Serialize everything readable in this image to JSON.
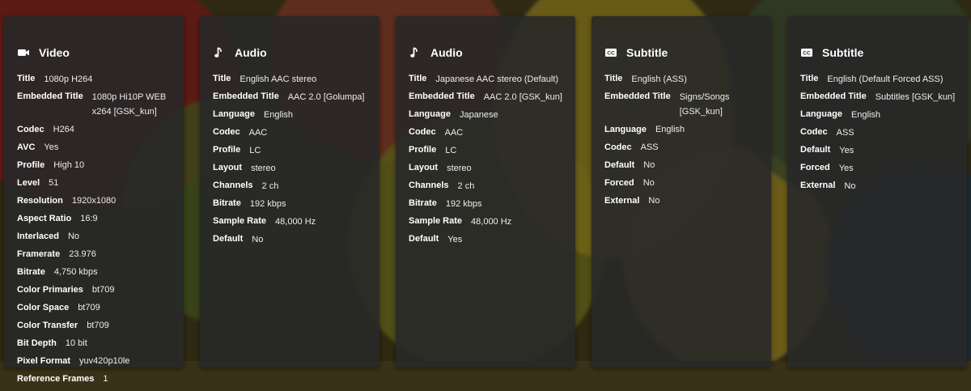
{
  "colors": {
    "card_bg": "#282828",
    "text": "#ffffff",
    "value_text": "#ededed"
  },
  "cards": [
    {
      "icon": "video-camera-icon",
      "title": "Video",
      "rows": [
        {
          "label": "Title",
          "value": "1080p H264"
        },
        {
          "label": "Embedded Title",
          "value": "1080p Hi10P WEB x264 [GSK_kun]"
        },
        {
          "label": "Codec",
          "value": "H264"
        },
        {
          "label": "AVC",
          "value": "Yes"
        },
        {
          "label": "Profile",
          "value": "High 10"
        },
        {
          "label": "Level",
          "value": "51"
        },
        {
          "label": "Resolution",
          "value": "1920x1080"
        },
        {
          "label": "Aspect Ratio",
          "value": "16:9"
        },
        {
          "label": "Interlaced",
          "value": "No"
        },
        {
          "label": "Framerate",
          "value": "23.976"
        },
        {
          "label": "Bitrate",
          "value": "4,750 kbps"
        },
        {
          "label": "Color Primaries",
          "value": "bt709"
        },
        {
          "label": "Color Space",
          "value": "bt709"
        },
        {
          "label": "Color Transfer",
          "value": "bt709"
        },
        {
          "label": "Bit Depth",
          "value": "10 bit"
        },
        {
          "label": "Pixel Format",
          "value": "yuv420p10le"
        },
        {
          "label": "Reference Frames",
          "value": "1"
        }
      ]
    },
    {
      "icon": "music-note-icon",
      "title": "Audio",
      "rows": [
        {
          "label": "Title",
          "value": "English AAC stereo"
        },
        {
          "label": "Embedded Title",
          "value": "AAC 2.0 [Golumpa]"
        },
        {
          "label": "Language",
          "value": "English"
        },
        {
          "label": "Codec",
          "value": "AAC"
        },
        {
          "label": "Profile",
          "value": "LC"
        },
        {
          "label": "Layout",
          "value": "stereo"
        },
        {
          "label": "Channels",
          "value": "2 ch"
        },
        {
          "label": "Bitrate",
          "value": "192 kbps"
        },
        {
          "label": "Sample Rate",
          "value": "48,000 Hz"
        },
        {
          "label": "Default",
          "value": "No"
        }
      ]
    },
    {
      "icon": "music-note-icon",
      "title": "Audio",
      "rows": [
        {
          "label": "Title",
          "value": "Japanese AAC stereo (Default)"
        },
        {
          "label": "Embedded Title",
          "value": "AAC 2.0 [GSK_kun]"
        },
        {
          "label": "Language",
          "value": "Japanese"
        },
        {
          "label": "Codec",
          "value": "AAC"
        },
        {
          "label": "Profile",
          "value": "LC"
        },
        {
          "label": "Layout",
          "value": "stereo"
        },
        {
          "label": "Channels",
          "value": "2 ch"
        },
        {
          "label": "Bitrate",
          "value": "192 kbps"
        },
        {
          "label": "Sample Rate",
          "value": "48,000 Hz"
        },
        {
          "label": "Default",
          "value": "Yes"
        }
      ]
    },
    {
      "icon": "closed-caption-icon",
      "title": "Subtitle",
      "rows": [
        {
          "label": "Title",
          "value": "English (ASS)"
        },
        {
          "label": "Embedded Title",
          "value": "Signs/Songs [GSK_kun]"
        },
        {
          "label": "Language",
          "value": "English"
        },
        {
          "label": "Codec",
          "value": "ASS"
        },
        {
          "label": "Default",
          "value": "No"
        },
        {
          "label": "Forced",
          "value": "No"
        },
        {
          "label": "External",
          "value": "No"
        }
      ]
    },
    {
      "icon": "closed-caption-icon",
      "title": "Subtitle",
      "rows": [
        {
          "label": "Title",
          "value": "English (Default Forced ASS)"
        },
        {
          "label": "Embedded Title",
          "value": "Subtitles [GSK_kun]"
        },
        {
          "label": "Language",
          "value": "English"
        },
        {
          "label": "Codec",
          "value": "ASS"
        },
        {
          "label": "Default",
          "value": "Yes"
        },
        {
          "label": "Forced",
          "value": "Yes"
        },
        {
          "label": "External",
          "value": "No"
        }
      ]
    }
  ]
}
